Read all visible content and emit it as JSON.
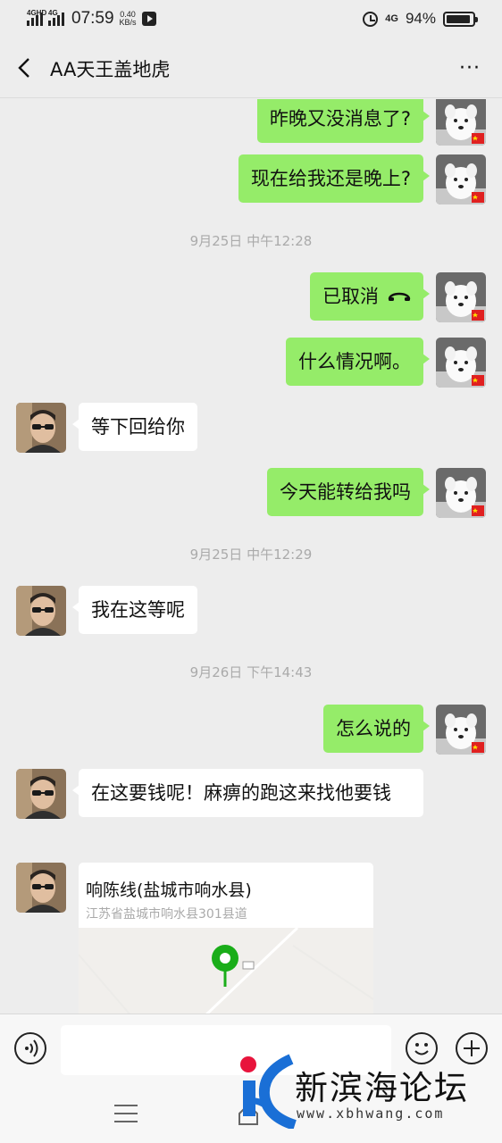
{
  "status_bar": {
    "signal1_label": "4GHD",
    "signal2_label": "4G",
    "time": "07:59",
    "speed_value": "0.40",
    "speed_unit": "KB/s",
    "network": "4G",
    "battery_percent": "94%",
    "battery_level": 0.94
  },
  "header": {
    "title": "AA天王盖地虎",
    "more": "···",
    "back_icon": "chevron-left-icon"
  },
  "messages": [
    {
      "side": "me",
      "text": "昨晚又没消息了?"
    },
    {
      "side": "me",
      "text": "现在给我还是晚上?"
    },
    {
      "timestamp": "9月25日 中午12:28"
    },
    {
      "side": "me",
      "text": "已取消",
      "icon": "hangup-icon"
    },
    {
      "side": "me",
      "text": "什么情况啊。"
    },
    {
      "side": "them",
      "text": "等下回给你"
    },
    {
      "side": "me",
      "text": "今天能转给我吗"
    },
    {
      "timestamp": "9月25日 中午12:29"
    },
    {
      "side": "them",
      "text": "我在这等呢"
    },
    {
      "timestamp": "9月26日 下午14:43"
    },
    {
      "side": "me",
      "text": "怎么说的"
    },
    {
      "side": "them",
      "text": "在这要钱呢！麻痹的跑这来找他要钱"
    },
    {
      "side": "them",
      "type": "location",
      "name": "响陈线(盐城市响水县)",
      "address": "江苏省盐城市响水县301县道"
    }
  ],
  "input_bar": {
    "placeholder": "",
    "voice_icon": "voice-icon",
    "emoji_icon": "emoji-icon",
    "plus_icon": "plus-icon"
  },
  "nav_bar": {
    "menu_icon": "menu-icon",
    "home_icon": "home-icon"
  },
  "watermark": {
    "text": "新滨海论坛",
    "url": "www.xbhwang.com"
  },
  "colors": {
    "background": "#ededed",
    "my_bubble": "#95ec69",
    "their_bubble": "#ffffff",
    "timestamp": "#aaaaaa",
    "map_pin": "#1aad19"
  }
}
